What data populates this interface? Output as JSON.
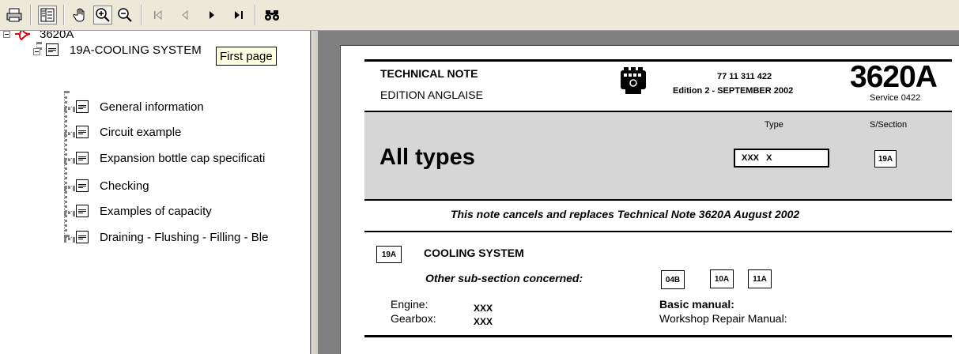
{
  "toolbar": {
    "buttons": [
      {
        "icon": "print-icon"
      },
      {
        "icon": "bookmarks-panel-icon"
      },
      {
        "icon": "hand-tool-icon"
      },
      {
        "icon": "zoom-in-icon"
      },
      {
        "icon": "zoom-out-icon"
      },
      {
        "icon": "first-page-icon"
      },
      {
        "icon": "previous-page-icon"
      },
      {
        "icon": "next-page-icon"
      },
      {
        "icon": "last-page-icon"
      },
      {
        "icon": "find-binoculars-icon"
      }
    ]
  },
  "tooltip": "First page",
  "tree": {
    "root": "3620A",
    "section": "19A-COOLING SYSTEM",
    "items": [
      "General information",
      "Circuit example",
      "Expansion bottle cap specificati",
      "Checking",
      "Examples of capacity",
      "Draining - Flushing - Filling - Ble"
    ]
  },
  "document": {
    "header_left_1": "TECHNICAL NOTE",
    "header_left_2": "EDITION ANGLAISE",
    "ref_number": "77 11 311 422",
    "edition": "Edition 2 - SEPTEMBER 2002",
    "note_number": "3620A",
    "service": "Service 0422",
    "type_label": "Type",
    "subsection_label": "S/Section",
    "type_heading": "All types",
    "type_value": "XXX   X",
    "subsection_value": "19A",
    "cancels_note": "This note cancels and replaces Technical Note 3620A August 2002",
    "section_code": "19A",
    "section_title": "COOLING SYSTEM",
    "other_subsection_label": "Other sub-section concerned:",
    "other_subsections": [
      "04B",
      "10A",
      "11A"
    ],
    "engine_label": "Engine:",
    "engine_value": "XXX",
    "gearbox_label": "Gearbox:",
    "gearbox_value": "XXX",
    "basic_manual_label": "Basic manual:",
    "basic_manual_value": "Workshop Repair Manual:"
  }
}
